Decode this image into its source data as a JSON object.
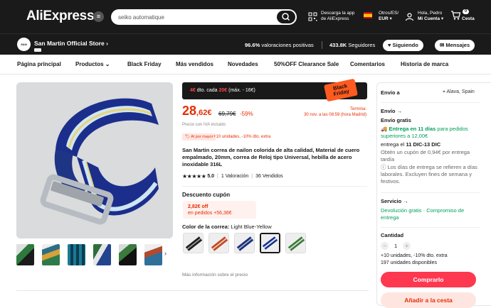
{
  "header": {
    "logo": "AliExpress",
    "search_value": "seiko automatique",
    "app_line1": "Descarga la app",
    "app_line2": "de AliExpress",
    "lang_line1": "Otros/ES/",
    "lang_line2": "EUR",
    "user_line1": "Hola, Pedro",
    "user_line2": "Mi Cuenta",
    "cart_count": "0",
    "cart_label": "Cesta"
  },
  "store": {
    "name": "San Martin Official Store",
    "logo_text": "SAN MARTIN",
    "rating_value": "96.6%",
    "rating_label": "valoraciones positivas",
    "followers_value": "433.8K",
    "followers_label": "Seguidores",
    "follow_btn": "Siguiendo",
    "message_btn": "Mensajes"
  },
  "nav": [
    "Página principal",
    "Productos",
    "Black Friday",
    "Más vendidos",
    "Novedades",
    "50%OFF Clearance Sale",
    "Comentarios",
    "Historia de marca"
  ],
  "promo": {
    "part1": "4€",
    "part2": " dto. cada ",
    "part3": "20€",
    "part4": " (máx. - 16€)",
    "badge_line1": "Black",
    "badge_line2": "Friday"
  },
  "price": {
    "main": "28",
    "cents": ",62€",
    "old": "69,79€",
    "discount": "-59%",
    "ends_line1": "Termina:",
    "ends_line2": "30 nov. a las 08:59 (hora Madrid)",
    "vat": "Precio con IVA incluido"
  },
  "wholesale": {
    "badge": "Al por mayor",
    "units": "+10 unidades, -10% dto. extra"
  },
  "product": {
    "title": "San Martin correa de nailon colorida de alta calidad, Material de cuero empalmado, 20mm, correa de Reloj tipo Universal, hebilla de acero inoxidable 316L",
    "stars": "★★★★★",
    "rating": "5.0",
    "reviews": "1 Valoración",
    "sold": "36 Vendidos"
  },
  "coupon": {
    "title": "Descuento cupón",
    "amount": "2,82€ off",
    "condition": "en pedidos +56,36€"
  },
  "color": {
    "label": "Color de la correa:",
    "value": "Light Blue-Yellow"
  },
  "more_info": "Más información sobre el precio",
  "side": {
    "ship_to": "Envío a",
    "location": "Alava, Spain",
    "envio": "Envío",
    "free": "Envío gratis",
    "delivery_green": "Entrega en 11 días",
    "delivery_rest": "para pedidos superiores a 12,00€",
    "delivery_date_pre": "entrega el",
    "delivery_date": "11 DIC-13 DIC",
    "late_coupon": "Obtén un cupón de 0,94€ por entrega tardía",
    "workdays": "Los días de entrega se refieren a días laborales. Excluyen fines de semana y festivos.",
    "service": "Servicio",
    "service_detail": "Devolución gratis · Compromiso de entrega",
    "quantity": "Cantidad",
    "qty_value": "1",
    "qty_note": "+10 unidades, -10% dto. extra",
    "available": "197 unidades disponibles",
    "buy": "Comprarlo",
    "add_cart": "Añadir a la cesta"
  },
  "colors": {
    "brand_red": "#fd384f",
    "price_red": "#e62e04",
    "green": "#00a15c",
    "dark": "#1a1a1a"
  }
}
